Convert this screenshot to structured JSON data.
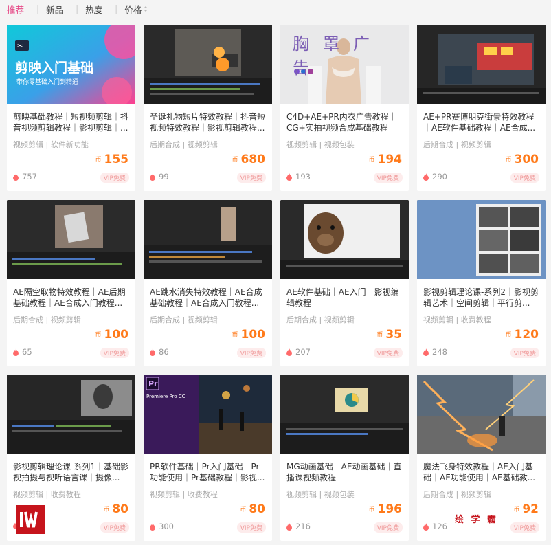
{
  "tabs": [
    {
      "label": "推荐",
      "active": true
    },
    {
      "label": "新品",
      "active": false
    },
    {
      "label": "热度",
      "active": false
    },
    {
      "label": "价格",
      "active": false
    }
  ],
  "currency": "币",
  "courses": [
    {
      "title": "剪映基础教程｜短视频剪辑｜抖音视频剪辑教程｜影视剪辑｜...",
      "tags": "视频剪辑 | 软件新功能",
      "price": "155",
      "views": "757",
      "vip": "VIP免费",
      "thumb_title": "剪映入门基础",
      "thumb_sub": "带你零基础入门到精通"
    },
    {
      "title": "圣诞礼物短片特效教程｜抖音短视频特效教程｜影视剪辑教程...",
      "tags": "后期合成 | 视频剪辑",
      "price": "680",
      "views": "99",
      "vip": "VIP免费"
    },
    {
      "title": "C4D+AE+PR内衣广告教程｜CG+实拍视频合成基础教程",
      "tags": "视频剪辑 | 视频包装",
      "price": "194",
      "views": "193",
      "vip": "VIP免费",
      "thumb_title": "胸罩广告"
    },
    {
      "title": "AE+PR赛博朋克街景特效教程｜AE软件基础教程｜AE合成...",
      "tags": "后期合成 | 视频剪辑",
      "price": "300",
      "views": "290",
      "vip": "VIP免费"
    },
    {
      "title": "AE隔空取物特效教程｜AE后期基础教程｜AE合成入门教程...",
      "tags": "后期合成 | 视频剪辑",
      "price": "100",
      "views": "65",
      "vip": "VIP免费"
    },
    {
      "title": "AE跳水消失特效教程｜AE合成基础教程｜AE合成入门教程...",
      "tags": "后期合成 | 视频剪辑",
      "price": "100",
      "views": "86",
      "vip": "VIP免费"
    },
    {
      "title": "AE软件基础｜AE入门｜影视编辑教程",
      "tags": "后期合成 | 视频剪辑",
      "price": "35",
      "views": "207",
      "vip": "VIP免费"
    },
    {
      "title": "影视剪辑理论课-系列2｜影视剪辑艺术｜空间剪辑｜平行剪...",
      "tags": "视频剪辑 | 收费教程",
      "price": "120",
      "views": "248",
      "vip": "VIP免费"
    },
    {
      "title": "影视剪辑理论课-系列1｜基础影视拍摄与视听语言课｜摄像...",
      "tags": "视频剪辑 | 收费教程",
      "price": "80",
      "views": "",
      "vip": "VIP免费"
    },
    {
      "title": "PR软件基础｜Pr入门基础｜Pr功能使用｜Pr基础教程｜影视...",
      "tags": "视频剪辑 | 收费教程",
      "price": "80",
      "views": "300",
      "vip": "VIP免费",
      "thumb_title": "Pr",
      "thumb_sub": "Premiere Pro CC"
    },
    {
      "title": "MG动画基础｜AE动画基础｜直播课视频教程",
      "tags": "视频剪辑 | 视频包装",
      "price": "196",
      "views": "216",
      "vip": "VIP免费"
    },
    {
      "title": "魔法飞身特效教程｜AE入门基础｜AE功能使用｜AE基础教...",
      "tags": "后期合成 | 视频剪辑",
      "price": "92",
      "views": "126",
      "vip": "VIP免费"
    }
  ],
  "watermark": {
    "text": "绘 学 霸"
  }
}
